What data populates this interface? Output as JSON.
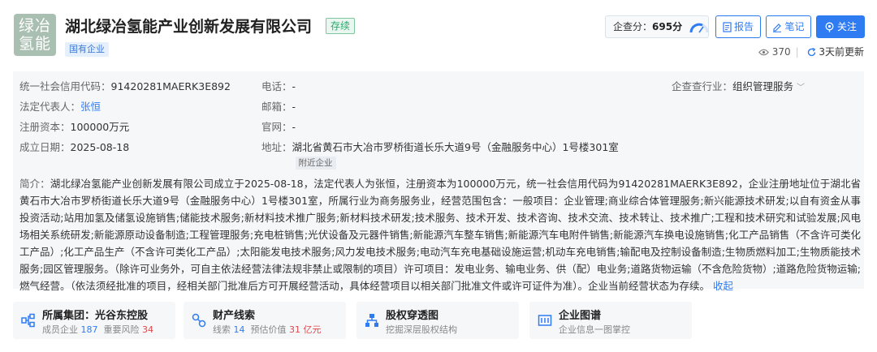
{
  "header": {
    "logo_text": "绿冶\n氢能",
    "company_name": "湖北绿冶氢能产业创新发展有限公司",
    "status": "存续",
    "company_type": "国有企业",
    "score_label": "企查分：",
    "score_value": "695分",
    "report_label": "报告",
    "note_label": "笔记",
    "follow_label": "关注",
    "views": "370",
    "updated": "3天前更新"
  },
  "info": {
    "credit_code_label": "统一社会信用代码：",
    "credit_code": "91420281MAERK3E892",
    "legal_rep_label": "法定代表人：",
    "legal_rep": "张恒",
    "capital_label": "注册资本：",
    "capital": "100000万元",
    "founded_label": "成立日期：",
    "founded": "2025-08-18",
    "phone_label": "电话：",
    "phone": "-",
    "email_label": "邮箱：",
    "email": "-",
    "website_label": "官网：",
    "website": "-",
    "address_label": "地址：",
    "address": "湖北省黄石市大冶市罗桥街道长乐大道9号（金融服务中心）1号楼301室",
    "near_label": "附近企业",
    "industry_label": "企查查行业：",
    "industry": "组织管理服务"
  },
  "intro": {
    "label": "简介：",
    "text": "湖北绿冶氢能产业创新发展有限公司成立于2025-08-18，法定代表人为张恒，注册资本为100000万元，统一社会信用代码为91420281MAERK3E892，企业注册地址位于湖北省黄石市大冶市罗桥街道长乐大道9号（金融服务中心）1号楼301室，所属行业为商务服务业，经营范围包含：一般项目：企业管理;商业综合体管理服务;新兴能源技术研发;以自有资金从事投资活动;站用加氢及储氢设施销售;储能技术服务;新材料技术推广服务;新材料技术研发;技术服务、技术开发、技术咨询、技术交流、技术转让、技术推广;工程和技术研究和试验发展;风电场相关系统研发;新能源原动设备制造;工程管理服务;充电桩销售;光伏设备及元器件销售;新能源汽车整车销售;新能源汽车电附件销售;新能源汽车换电设施销售;化工产品销售（不含许可类化工产品）;化工产品生产（不含许可类化工产品）;太阳能发电技术服务;风力发电技术服务;电动汽车充电基础设施运营;机动车充电销售;输配电及控制设备制造;生物质燃料加工;生物质能技术服务;园区管理服务。（除许可业务外，可自主依法经营法律法规非禁止或限制的项目）许可项目：发电业务、输电业务、供（配）电业务;道路货物运输（不含危险货物）;道路危险货物运输;燃气经营。（依法须经批准的项目，经相关部门批准后方可开展经营活动，具体经营项目以相关部门批准文件或许可证件为准）。企业当前经营状态为存续。",
    "collapse": "收起"
  },
  "cards": [
    {
      "title": "所属集团：光谷东控股",
      "sub_a": "成员企业",
      "sub_a_val": "187",
      "sub_b": "重要风险",
      "sub_b_val": "34"
    },
    {
      "title": "财产线索",
      "sub_a": "线索",
      "sub_a_val": "14",
      "sub_b": "预估价值",
      "sub_b_val": "31",
      "sub_b_unit": "亿元"
    },
    {
      "title": "股权穿透图",
      "sub_a": "挖掘深层股权结构"
    },
    {
      "title": "企业图谱",
      "sub_a": "企业信息一图掌控"
    }
  ],
  "colors": {
    "accent": "#2f7cf2",
    "status_green": "#2aa86d",
    "risk_red": "#e0474b",
    "panel_bg": "#f6f7f9"
  }
}
